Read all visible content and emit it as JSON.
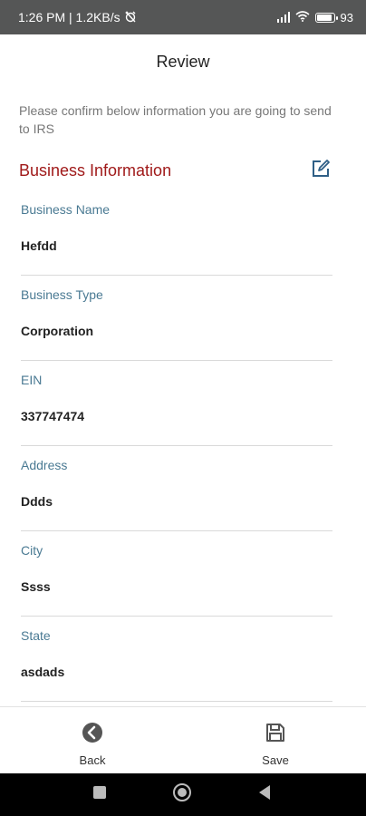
{
  "status_bar": {
    "time_info": "1:26 PM | 1.2KB/s",
    "battery_percent": "93",
    "battery_level": 0.93
  },
  "page": {
    "title": "Review",
    "intro_text": "Please confirm below information you are going to send to IRS"
  },
  "section": {
    "title": "Business Information",
    "edit_icon": "edit-icon"
  },
  "fields": [
    {
      "label": "Business Name",
      "value": "Hefdd"
    },
    {
      "label": "Business Type",
      "value": "Corporation"
    },
    {
      "label": "EIN",
      "value": "337747474"
    },
    {
      "label": "Address",
      "value": "Ddds"
    },
    {
      "label": "City",
      "value": "Ssss"
    },
    {
      "label": "State",
      "value": "asdads"
    }
  ],
  "actions": {
    "back_label": "Back",
    "save_label": "Save"
  },
  "colors": {
    "accent_red": "#a01a1a",
    "label_blue": "#4a7a93",
    "icon_gray": "#555555"
  }
}
